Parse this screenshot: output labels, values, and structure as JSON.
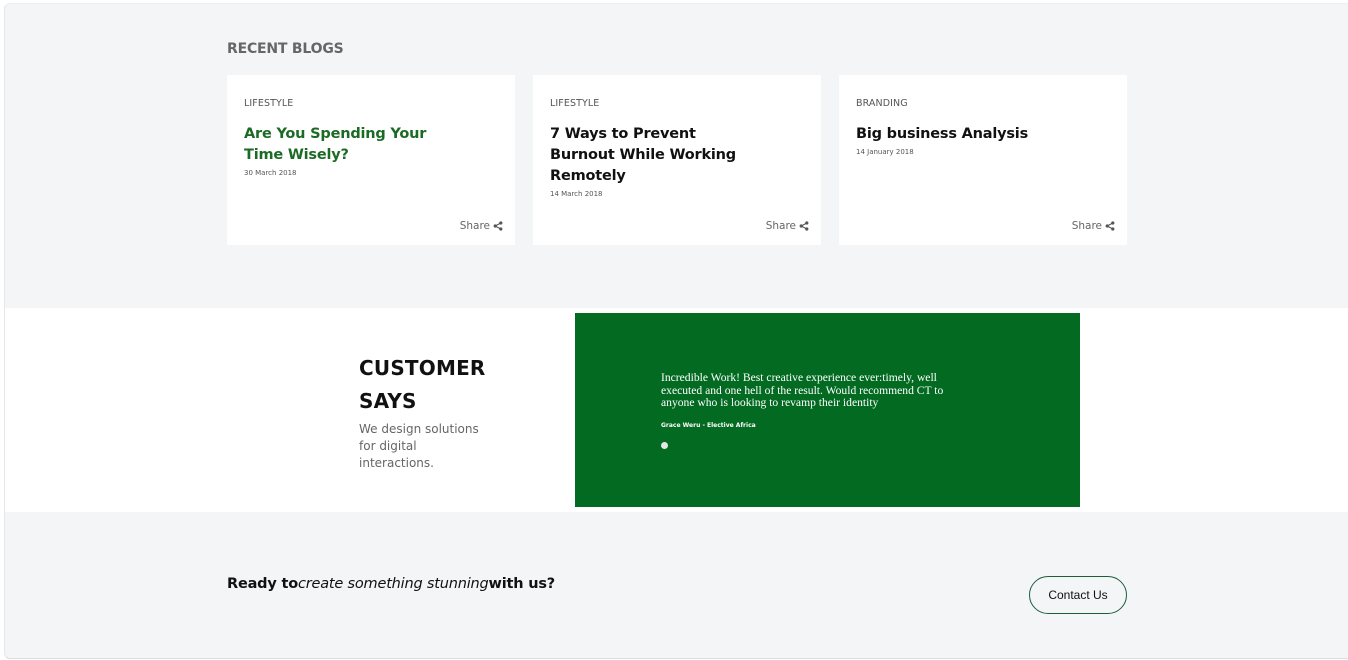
{
  "recent_blogs": {
    "heading": "RECENT BLOGS",
    "share_label": "Share",
    "cards": [
      {
        "category": "LIFESTYLE",
        "title": "Are You Spending Your Time Wisely?",
        "date": "30 March 2018"
      },
      {
        "category": "LIFESTYLE",
        "title": "7 Ways to Prevent Burnout While Working Remotely",
        "date": "14 March 2018"
      },
      {
        "category": "BRANDING",
        "title": "Big business Analysis",
        "date": "14 January 2018"
      }
    ]
  },
  "testimonials": {
    "title_line1": "CUSTOMER",
    "title_line2": "SAYS",
    "subtitle": "We design solutions for digital interactions.",
    "quote": "Incredible Work! Best creative experience ever:timely, well executed and one hell of the result. Would recommend CT to anyone who is looking to revamp their identity",
    "author": "Grace Weru - Elective Africa",
    "accent_color": "#026b21"
  },
  "cta": {
    "part1": "Ready to",
    "part2": "create something stunning",
    "part3": "with us?",
    "button_label": "Contact Us"
  },
  "colors": {
    "page_bg": "#f4f5f7",
    "highlight_title": "#1c6b25"
  },
  "icons": [
    "share-icon"
  ]
}
